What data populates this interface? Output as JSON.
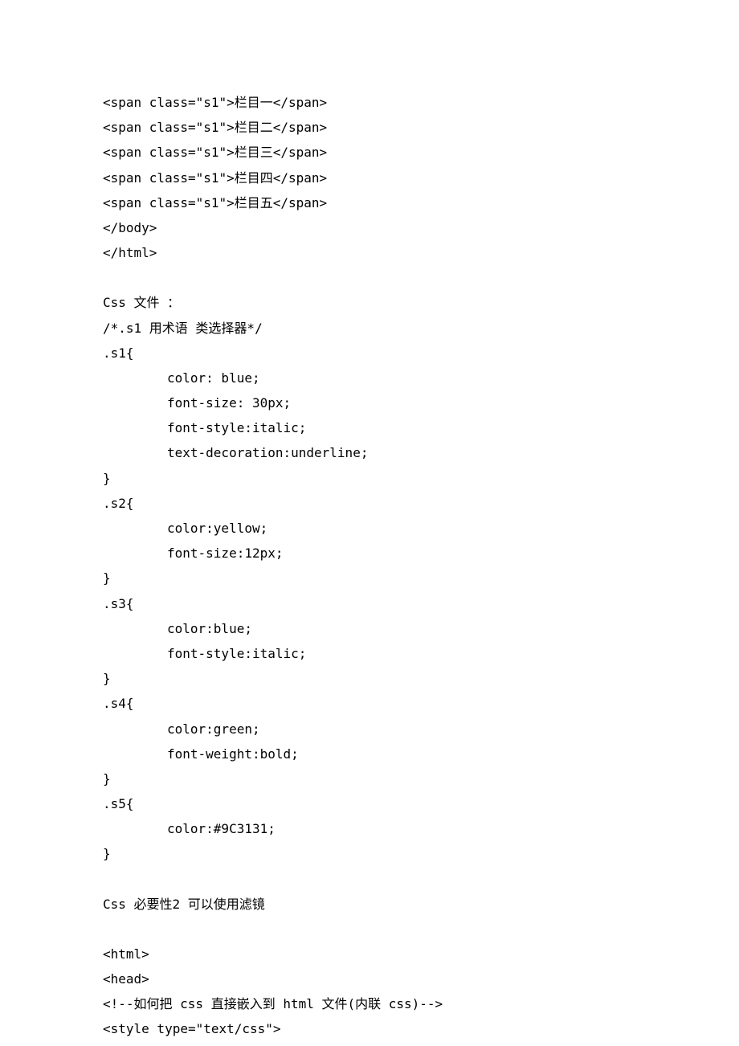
{
  "lines": {
    "l1": "<span class=\"s1\">栏目一</span>",
    "l2": "<span class=\"s1\">栏目二</span>",
    "l3": "<span class=\"s1\">栏目三</span>",
    "l4": "<span class=\"s1\">栏目四</span>",
    "l5": "<span class=\"s1\">栏目五</span>",
    "l6": "</body>",
    "l7": "</html>",
    "l8": "Css 文件 ：",
    "l9": "/*.s1 用术语 类选择器*/",
    "l10": ".s1{",
    "l11": "color: blue;",
    "l12": "font-size: 30px;",
    "l13": "font-style:italic;",
    "l14": "text-decoration:underline;",
    "l15": "}",
    "l16": ".s2{",
    "l17": "color:yellow;",
    "l18": "font-size:12px;",
    "l19": "}",
    "l20": ".s3{",
    "l21": "color:blue;",
    "l22": "font-style:italic;",
    "l23": "}",
    "l24": ".s4{",
    "l25": "color:green;",
    "l26": "font-weight:bold;",
    "l27": "}",
    "l28": ".s5{",
    "l29": "color:#9C3131;",
    "l30": "}",
    "l31": "Css 必要性2 可以使用滤镜",
    "l32": "<html>",
    "l33": "<head>",
    "l34": "<!--如何把 css 直接嵌入到 html 文件(内联 css)-->",
    "l35": "<style type=\"text/css\">"
  }
}
